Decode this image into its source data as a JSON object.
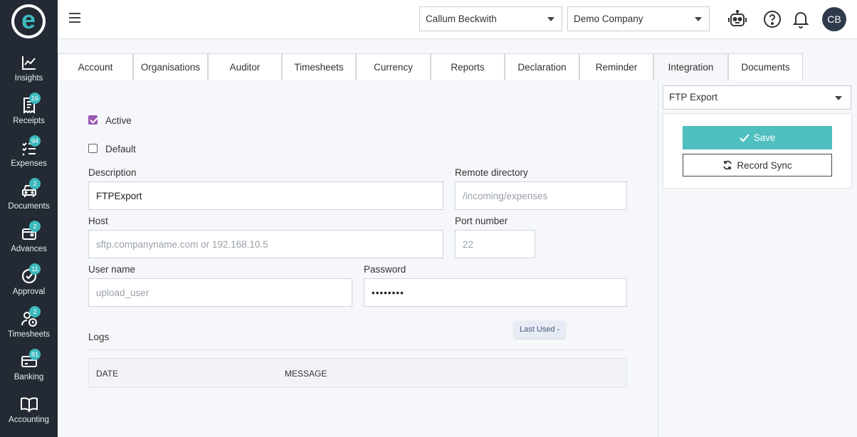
{
  "brand": {
    "logo_letter": "e",
    "accent": "#3cb9bd"
  },
  "sidebar": {
    "items": [
      {
        "label": "Insights",
        "icon": "chart-line-icon",
        "badge": ""
      },
      {
        "label": "Receipts",
        "icon": "receipt-icon",
        "badge": "16"
      },
      {
        "label": "Expenses",
        "icon": "checklist-icon",
        "badge": "94"
      },
      {
        "label": "Documents",
        "icon": "car-icon",
        "badge": "2"
      },
      {
        "label": "Advances",
        "icon": "wallet-icon",
        "badge": "2"
      },
      {
        "label": "Approval",
        "icon": "check-circle-icon",
        "badge": "11"
      },
      {
        "label": "Timesheets",
        "icon": "user-clock-icon",
        "badge": "2"
      },
      {
        "label": "Banking",
        "icon": "bank-card-icon",
        "badge": "81"
      },
      {
        "label": "Accounting",
        "icon": "book-icon",
        "badge": ""
      }
    ]
  },
  "header": {
    "user_select": "Callum Beckwith",
    "company_select": "Demo Company",
    "avatar_initials": "CB"
  },
  "tabs": [
    {
      "label": "Account"
    },
    {
      "label": "Organisations"
    },
    {
      "label": "Auditor"
    },
    {
      "label": "Timesheets"
    },
    {
      "label": "Currency"
    },
    {
      "label": "Reports"
    },
    {
      "label": "Declaration"
    },
    {
      "label": "Reminder"
    },
    {
      "label": "Integration"
    },
    {
      "label": "Documents"
    }
  ],
  "form": {
    "active_label": "Active",
    "default_label": "Default",
    "description_label": "Description",
    "description_value": "FTPExport",
    "remote_dir_label": "Remote directory",
    "remote_dir_placeholder": "/incoming/expenses",
    "host_label": "Host",
    "host_placeholder": "sftp.companyname.com or 192.168.10.5",
    "port_label": "Port number",
    "port_placeholder": "22",
    "username_label": "User name",
    "username_placeholder": "upload_user",
    "password_label": "Password",
    "password_value": "passw0rd"
  },
  "logs": {
    "title": "Logs",
    "last_used": "Last Used -",
    "col_date": "DATE",
    "col_message": "MESSAGE"
  },
  "right_panel": {
    "integration_select": "FTP Export",
    "save_label": "Save",
    "sync_label": "Record Sync"
  }
}
